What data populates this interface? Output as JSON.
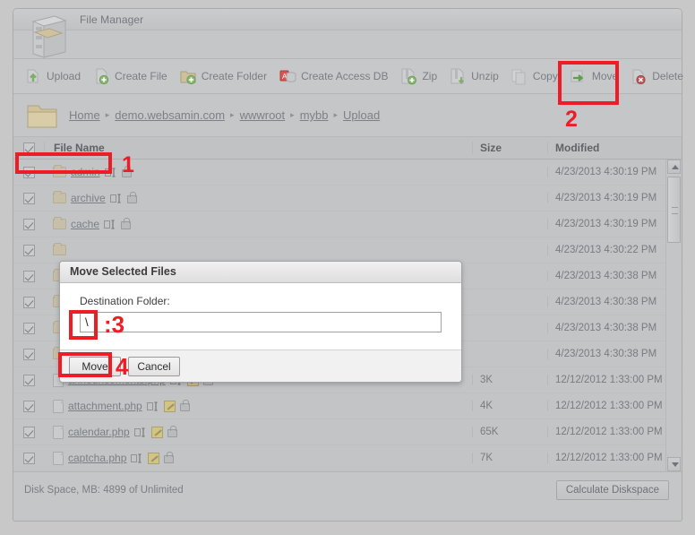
{
  "window": {
    "title": "File Manager",
    "app_icon": "file-cabinet-icon"
  },
  "toolbar": {
    "items": [
      {
        "label": "Upload",
        "icon": "upload-icon"
      },
      {
        "label": "Create File",
        "icon": "create-file-icon"
      },
      {
        "label": "Create Folder",
        "icon": "create-folder-icon"
      },
      {
        "label": "Create Access DB",
        "icon": "database-icon"
      },
      {
        "label": "Zip",
        "icon": "zip-icon"
      },
      {
        "label": "Unzip",
        "icon": "unzip-icon"
      },
      {
        "label": "Copy",
        "icon": "copy-icon"
      },
      {
        "label": "Move",
        "icon": "move-icon"
      },
      {
        "label": "Delete",
        "icon": "delete-icon"
      }
    ]
  },
  "breadcrumb": {
    "folder_icon": "folder-icon",
    "separator": "▸",
    "items": [
      {
        "label": "Home"
      },
      {
        "label": "demo.websamin.com"
      },
      {
        "label": "wwwroot"
      },
      {
        "label": "mybb"
      },
      {
        "label": "Upload"
      }
    ]
  },
  "table": {
    "headers": {
      "name": "File Name",
      "size": "Size",
      "modified": "Modified"
    },
    "select_all_checked": true,
    "rows": [
      {
        "name": "admin",
        "type": "folder",
        "size": "",
        "modified": "4/23/2013 4:30:19 PM",
        "checked": true
      },
      {
        "name": "archive",
        "type": "folder",
        "size": "",
        "modified": "4/23/2013 4:30:19 PM",
        "checked": true
      },
      {
        "name": "cache",
        "type": "folder",
        "size": "",
        "modified": "4/23/2013 4:30:19 PM",
        "checked": true
      },
      {
        "name": "",
        "type": "folder",
        "size": "",
        "modified": "4/23/2013 4:30:22 PM",
        "checked": true
      },
      {
        "name": "",
        "type": "folder",
        "size": "",
        "modified": "4/23/2013 4:30:38 PM",
        "checked": true
      },
      {
        "name": "",
        "type": "folder",
        "size": "",
        "modified": "4/23/2013 4:30:38 PM",
        "checked": true
      },
      {
        "name": "",
        "type": "folder",
        "size": "",
        "modified": "4/23/2013 4:30:38 PM",
        "checked": true
      },
      {
        "name": "",
        "type": "folder",
        "size": "",
        "modified": "4/23/2013 4:30:38 PM",
        "checked": true
      },
      {
        "name": "announcements.php",
        "type": "file",
        "size": "3K",
        "modified": "12/12/2012 1:33:00 PM",
        "checked": true
      },
      {
        "name": "attachment.php",
        "type": "file",
        "size": "4K",
        "modified": "12/12/2012 1:33:00 PM",
        "checked": true
      },
      {
        "name": "calendar.php",
        "type": "file",
        "size": "65K",
        "modified": "12/12/2012 1:33:00 PM",
        "checked": true
      },
      {
        "name": "captcha.php",
        "type": "file",
        "size": "7K",
        "modified": "12/12/2012 1:33:00 PM",
        "checked": true
      }
    ],
    "row_icons": {
      "rename": "rename-icon",
      "edit": "edit-icon",
      "permissions": "lock-icon"
    }
  },
  "dialog": {
    "title": "Move Selected Files",
    "field_label": "Destination Folder:",
    "field_value": "\\",
    "field_placeholder": "",
    "move_button": "Move",
    "cancel_button": "Cancel"
  },
  "footer": {
    "disk_space": "Disk Space, MB: 4899 of Unlimited",
    "calculate_button": "Calculate Diskspace"
  },
  "annotations": {
    "color": "#ee1c25",
    "markers": [
      {
        "number": "1",
        "target": "file-name-select-all-header"
      },
      {
        "number": "2",
        "target": "toolbar-move-button"
      },
      {
        "number": ":3",
        "target": "destination-folder-input"
      },
      {
        "number": "4",
        "target": "dialog-move-button"
      }
    ]
  },
  "scrollbar": {
    "up_arrow": "chevron-up-icon",
    "down_arrow": "chevron-down-icon"
  }
}
